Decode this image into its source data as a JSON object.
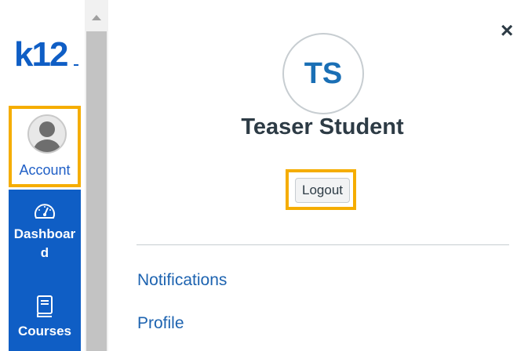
{
  "brand": {
    "logo_text": "k12",
    "accent": "#0f5ec5",
    "highlight": "#f5ad00"
  },
  "nav": {
    "account_label": "Account",
    "items": [
      {
        "label_line1": "Dashboar",
        "label_line2": "d",
        "icon": "dashboard-icon"
      },
      {
        "label_line1": "Courses",
        "icon": "courses-icon"
      }
    ]
  },
  "tray": {
    "close_symbol": "×",
    "initials": "TS",
    "user_name": "Teaser Student",
    "logout_label": "Logout",
    "links": [
      "Notifications",
      "Profile"
    ]
  }
}
